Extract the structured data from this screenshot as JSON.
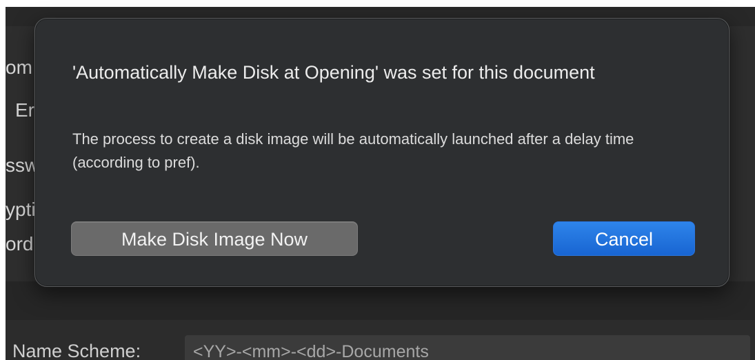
{
  "background": {
    "labels": [
      "om",
      "Er",
      "ssw",
      "ypti",
      "ord"
    ],
    "scheme_label": "Name Scheme:",
    "scheme_value": "<YY>-<mm>-<dd>-Documents"
  },
  "dialog": {
    "title": "'Automatically Make Disk at Opening' was set for this document",
    "message": "The process to create a disk image will be automatically launched after a delay time (according to pref).",
    "secondary_button": "Make Disk Image Now",
    "primary_button": "Cancel"
  },
  "colors": {
    "accent": "#1f72e2",
    "dialog_bg": "#2d2f31",
    "secondary_button_bg": "#6a6a6a"
  }
}
